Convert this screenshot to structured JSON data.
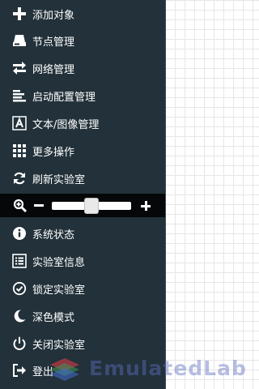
{
  "sidebar": {
    "items": [
      {
        "label": "添加对象",
        "icon": "plus-icon"
      },
      {
        "label": "节点管理",
        "icon": "hdd-icon"
      },
      {
        "label": "网络管理",
        "icon": "exchange-icon"
      },
      {
        "label": "启动配置管理",
        "icon": "align-left-icon"
      },
      {
        "label": "文本/图像管理",
        "icon": "font-icon"
      },
      {
        "label": "更多操作",
        "icon": "th-icon"
      },
      {
        "label": "刷新实验室",
        "icon": "refresh-icon"
      },
      {
        "label": "系统状态",
        "icon": "info-icon"
      },
      {
        "label": "实验室信息",
        "icon": "list-alt-icon"
      },
      {
        "label": "锁定实验室",
        "icon": "check-circle-icon"
      },
      {
        "label": "深色模式",
        "icon": "moon-icon"
      },
      {
        "label": "关闭实验室",
        "icon": "power-off-icon"
      },
      {
        "label": "登出",
        "icon": "sign-out-icon"
      }
    ]
  },
  "zoom": {
    "level": 0.5,
    "icons": [
      "zoom-in-icon",
      "minus-icon",
      "plus-icon"
    ]
  },
  "watermark": {
    "text": "EmulatedLab"
  },
  "colors": {
    "sidebar_bg": "#22313a",
    "zoom_bar_bg": "#050708",
    "text": "#ffffff",
    "canvas_grid": "#e6e6e6"
  }
}
